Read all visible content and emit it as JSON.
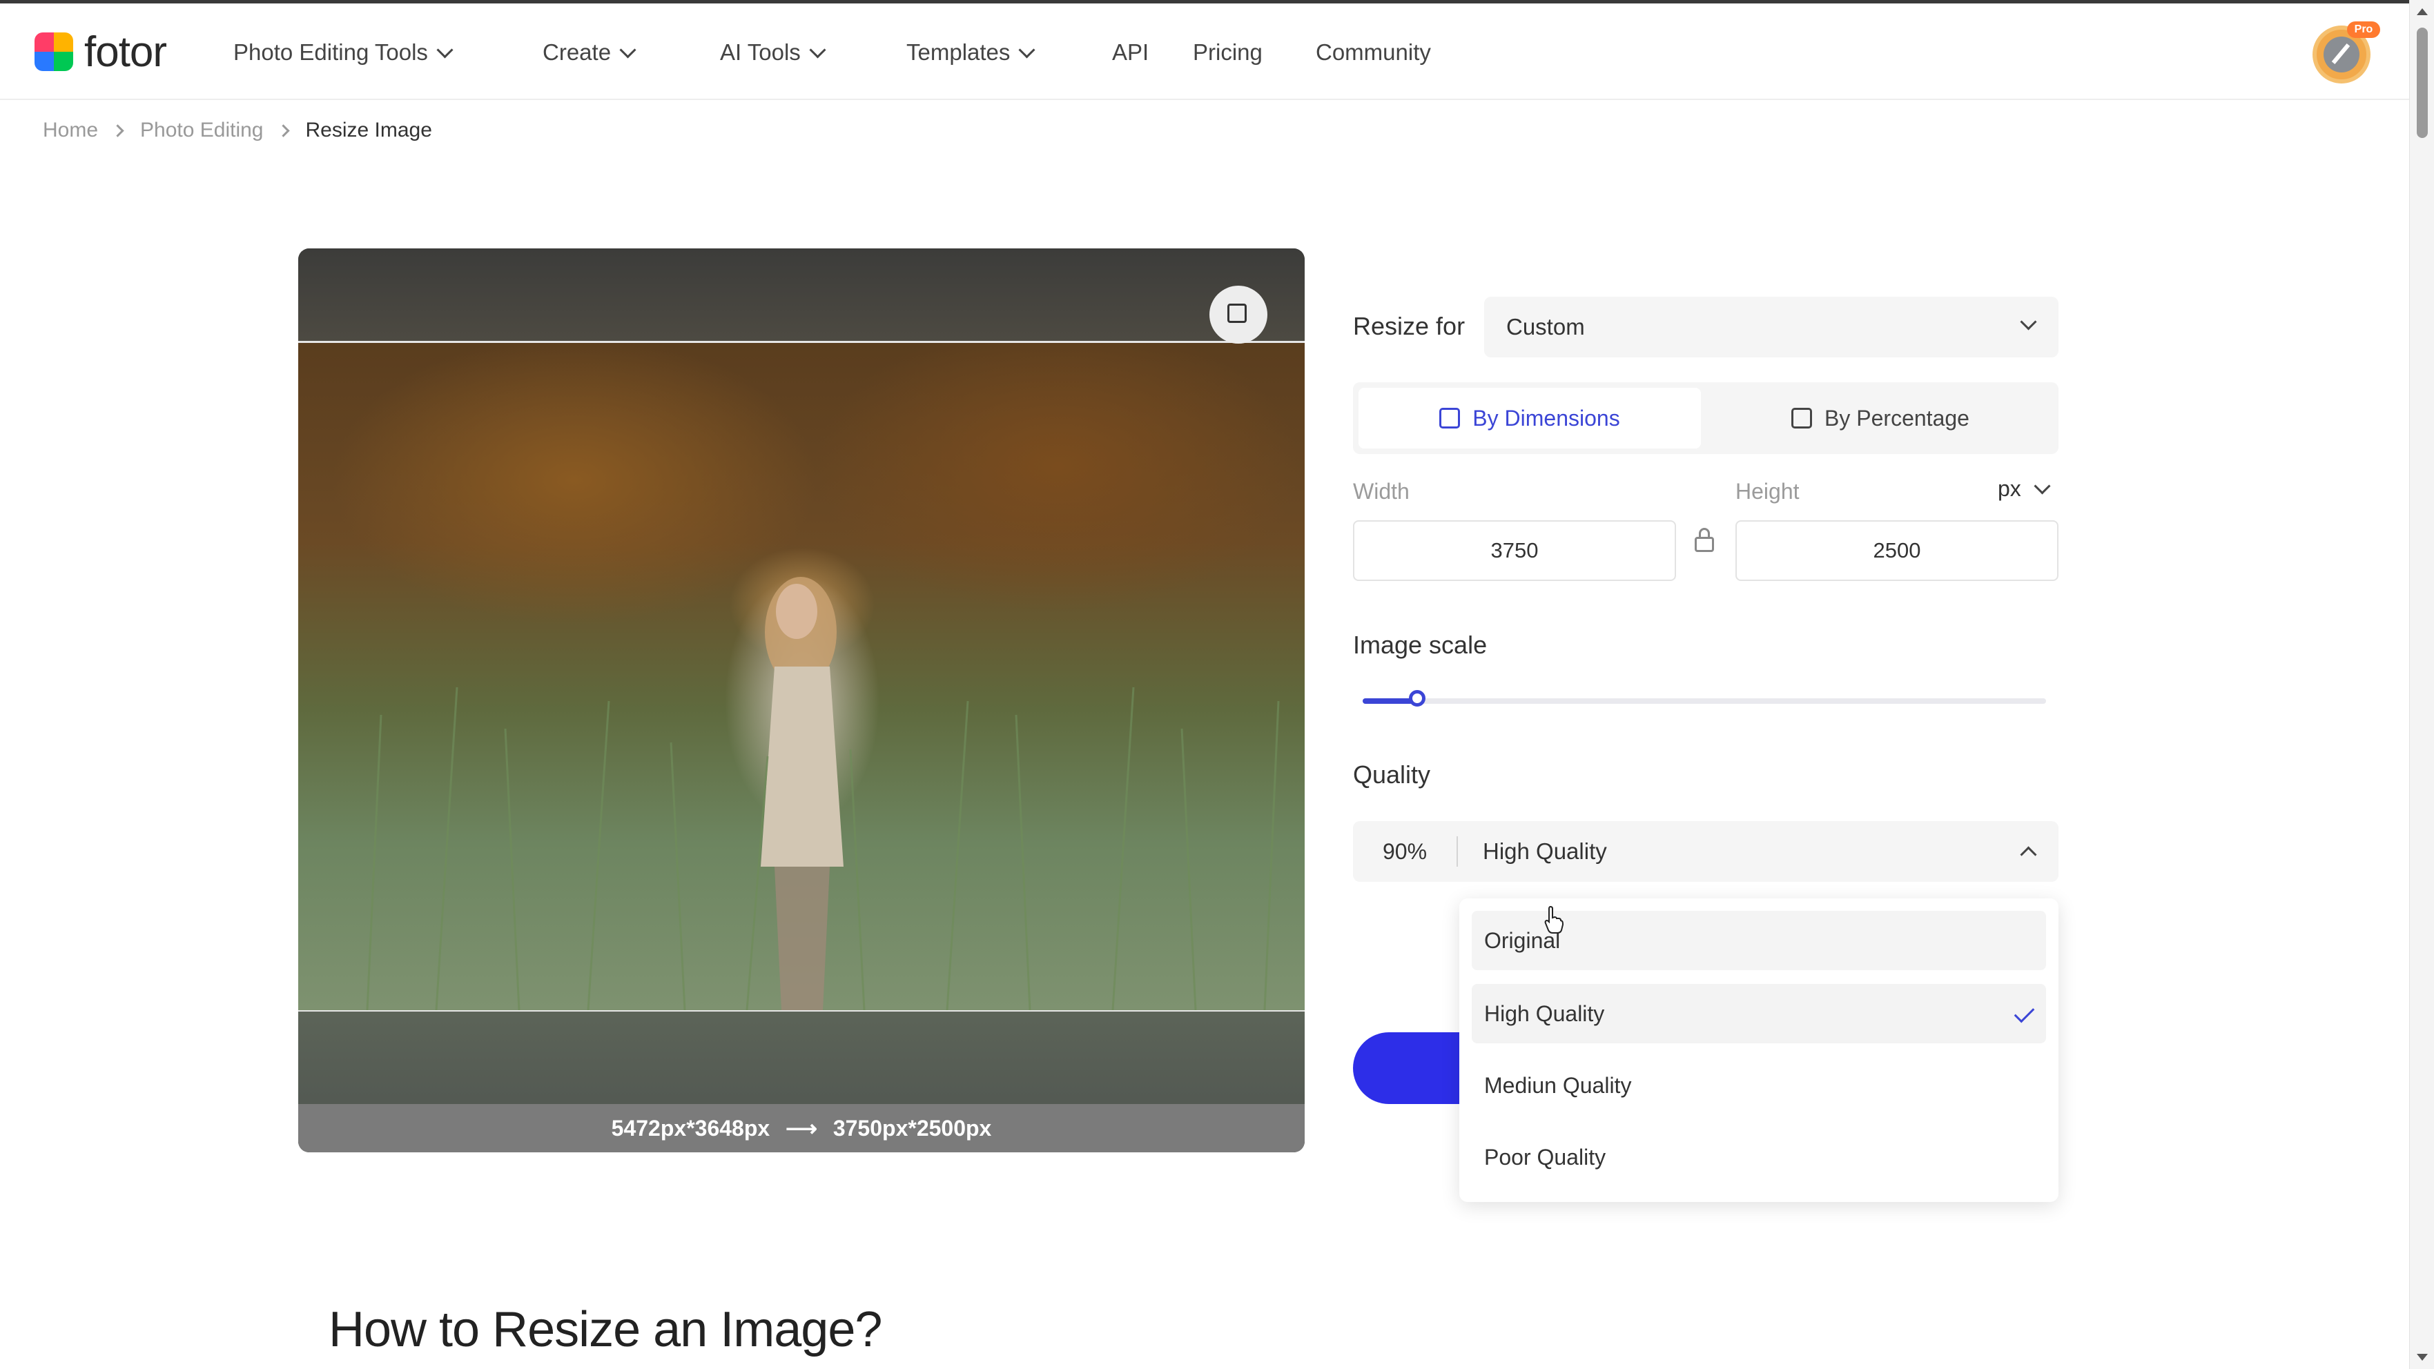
{
  "brand": {
    "name": "fotor",
    "logo_colors": [
      "#ff3d67",
      "#ffb300",
      "#2979ff",
      "#00c853"
    ]
  },
  "nav": {
    "items": [
      {
        "label": "Photo Editing Tools",
        "dropdown": true
      },
      {
        "label": "Create",
        "dropdown": true
      },
      {
        "label": "AI Tools",
        "dropdown": true
      },
      {
        "label": "Templates",
        "dropdown": true
      },
      {
        "label": "API",
        "dropdown": false
      },
      {
        "label": "Pricing",
        "dropdown": false
      },
      {
        "label": "Community",
        "dropdown": false
      }
    ],
    "avatar_badge": "Pro"
  },
  "breadcrumb": [
    "Home",
    "Photo Editing",
    "Resize Image"
  ],
  "preview": {
    "size_from": "5472px*3648px",
    "arrow": "⟶",
    "size_to": "3750px*2500px"
  },
  "panel": {
    "resize_for_label": "Resize for",
    "resize_for_value": "Custom",
    "tabs": [
      {
        "label": "By Dimensions",
        "active": true,
        "icon": "dimensions-icon"
      },
      {
        "label": "By Percentage",
        "active": false,
        "icon": "percentage-icon"
      }
    ],
    "width_label": "Width",
    "width_value": "3750",
    "height_label": "Height",
    "height_value": "2500",
    "unit": "px",
    "image_scale_label": "Image scale",
    "image_scale_level": 0.08,
    "quality_label": "Quality",
    "quality_percent": "90%",
    "quality_value": "High Quality",
    "quality_options": [
      {
        "label": "Original",
        "state": "hover"
      },
      {
        "label": "High Quality",
        "state": "selected"
      },
      {
        "label": "Mediun Quality",
        "state": ""
      },
      {
        "label": "Poor Quality",
        "state": ""
      }
    ],
    "accent_color": "#3b45d6",
    "button_color": "#2d2ee8"
  },
  "section": {
    "title": "How to Resize an Image?"
  }
}
